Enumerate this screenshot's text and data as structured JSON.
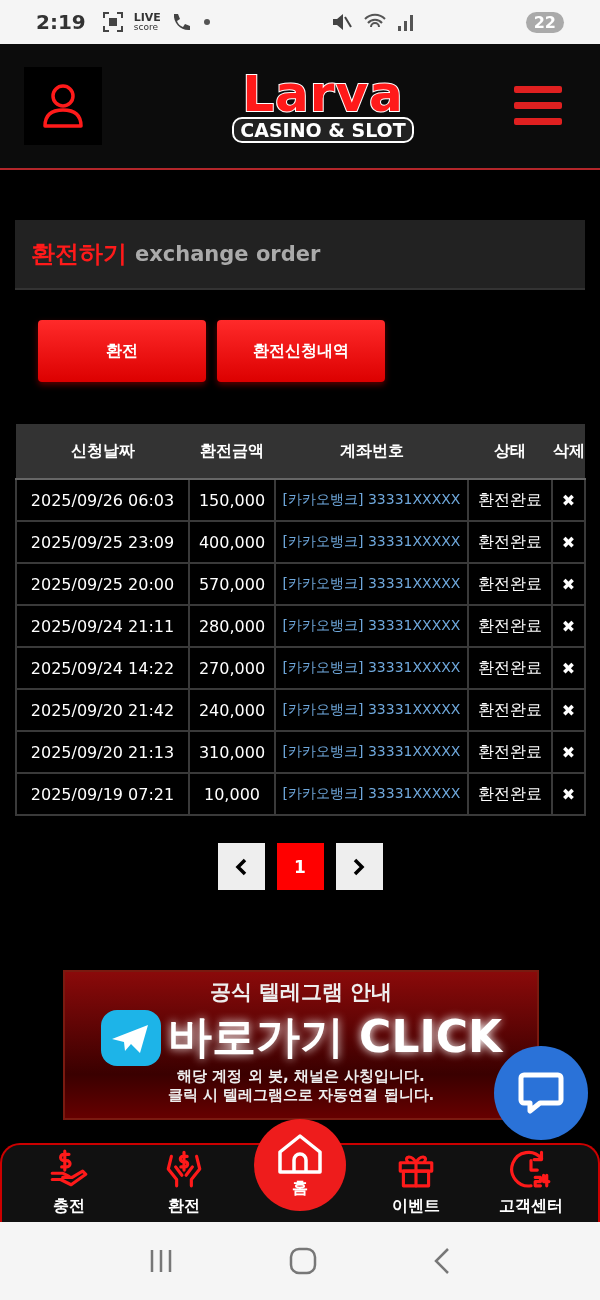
{
  "status_bar": {
    "time": "2:19",
    "live_top": "LIVE",
    "live_bottom": "score",
    "battery": "22"
  },
  "header": {
    "logo_title": "Larva",
    "logo_subtitle": "CASINO & SLOT"
  },
  "section": {
    "title": "환전하기",
    "subtitle": "exchange order"
  },
  "actions": [
    {
      "label": "환전"
    },
    {
      "label": "환전신청내역"
    }
  ],
  "table": {
    "columns": [
      "신청날짜",
      "환전금액",
      "계좌번호",
      "상태",
      "삭제"
    ],
    "rows": [
      {
        "date": "2025/09/26 06:03",
        "amount": "150,000",
        "account": "[카카오뱅크] 33331XXXXX",
        "status": "환전완료",
        "delete": "✖"
      },
      {
        "date": "2025/09/25 23:09",
        "amount": "400,000",
        "account": "[카카오뱅크] 33331XXXXX",
        "status": "환전완료",
        "delete": "✖"
      },
      {
        "date": "2025/09/25 20:00",
        "amount": "570,000",
        "account": "[카카오뱅크] 33331XXXXX",
        "status": "환전완료",
        "delete": "✖"
      },
      {
        "date": "2025/09/24 21:11",
        "amount": "280,000",
        "account": "[카카오뱅크] 33331XXXXX",
        "status": "환전완료",
        "delete": "✖"
      },
      {
        "date": "2025/09/24 14:22",
        "amount": "270,000",
        "account": "[카카오뱅크] 33331XXXXX",
        "status": "환전완료",
        "delete": "✖"
      },
      {
        "date": "2025/09/20 21:42",
        "amount": "240,000",
        "account": "[카카오뱅크] 33331XXXXX",
        "status": "환전완료",
        "delete": "✖"
      },
      {
        "date": "2025/09/20 21:13",
        "amount": "310,000",
        "account": "[카카오뱅크] 33331XXXXX",
        "status": "환전완료",
        "delete": "✖"
      },
      {
        "date": "2025/09/19 07:21",
        "amount": "10,000",
        "account": "[카카오뱅크] 33331XXXXX",
        "status": "환전완료",
        "delete": "✖"
      }
    ]
  },
  "pagination": {
    "pages": [
      {
        "label": "1",
        "selected": true
      }
    ]
  },
  "banner": {
    "heading": "공식 텔레그램 안내",
    "cta": "바로가기 CLICK",
    "note_1": "해당 계정 외 봇, 채널은 사칭입니다.",
    "note_2": "클릭 시 텔레그램으로 자동연결 됩니다."
  },
  "bottom_nav": [
    {
      "kind": "deposit",
      "label": "충전"
    },
    {
      "kind": "withdraw",
      "label": "환전"
    },
    {
      "kind": "home",
      "label": "홈"
    },
    {
      "kind": "event",
      "label": "이벤트"
    },
    {
      "kind": "support",
      "label": "고객센터"
    }
  ]
}
